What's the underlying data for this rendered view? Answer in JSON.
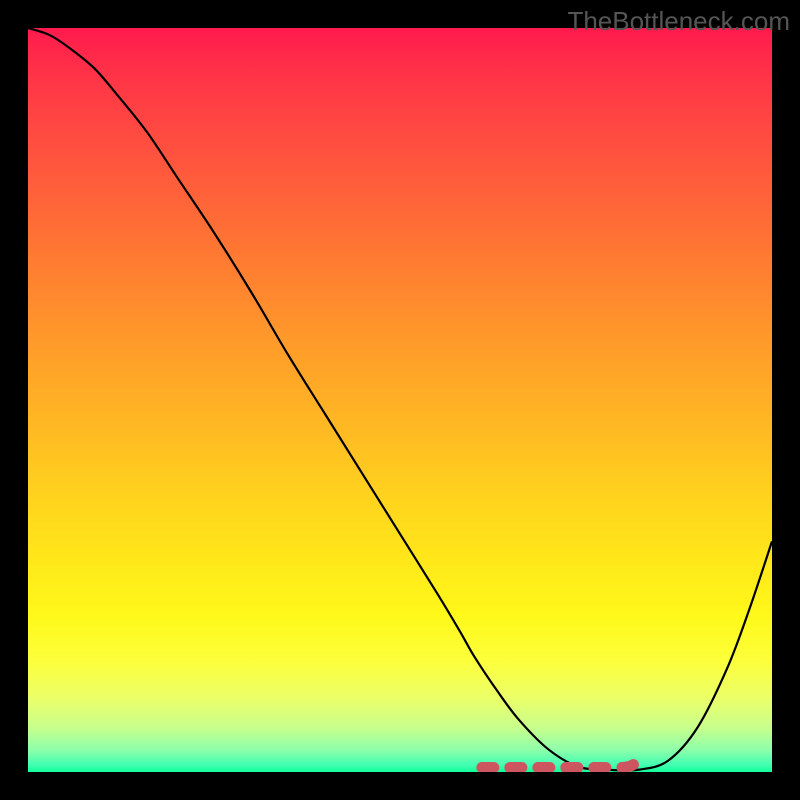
{
  "watermark": "TheBottleneck.com",
  "colors": {
    "background": "#000000",
    "curve": "#000000",
    "dash": "#cc5560",
    "gradient_top": "#ff1a4d",
    "gradient_bottom": "#11ff99"
  },
  "chart_data": {
    "type": "line",
    "title": "",
    "xlabel": "",
    "ylabel": "",
    "xlim": [
      0,
      100
    ],
    "ylim": [
      0,
      100
    ],
    "grid": false,
    "series": [
      {
        "name": "bottleneck-curve",
        "x": [
          0,
          3,
          6,
          9,
          12,
          16,
          20,
          25,
          30,
          35,
          40,
          45,
          50,
          55,
          58,
          60,
          63,
          66,
          70,
          74,
          78,
          82,
          86,
          90,
          94,
          97,
          100
        ],
        "values": [
          100,
          99,
          97,
          94.5,
          91,
          86,
          80,
          72.5,
          64.5,
          56,
          48,
          40,
          32,
          24,
          19,
          15.5,
          11,
          7,
          3,
          0.7,
          0.3,
          0.3,
          1.5,
          6,
          14,
          22,
          31
        ]
      }
    ],
    "flat_region": {
      "name": "optimal-flat-region",
      "x_start": 61,
      "x_end": 82,
      "y": 0.6
    }
  }
}
